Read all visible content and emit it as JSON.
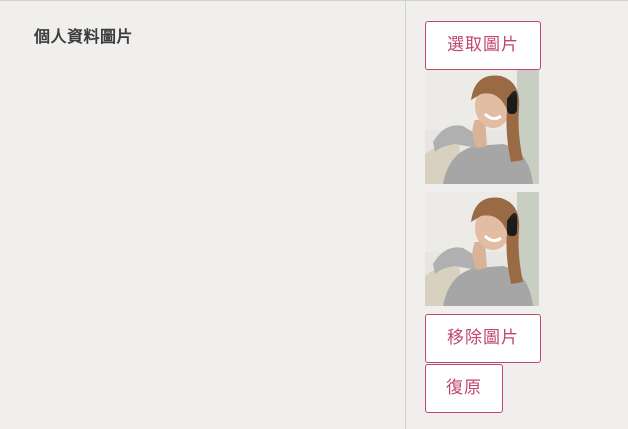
{
  "field": {
    "label": "個人資料圖片"
  },
  "actions": {
    "select_label": "選取圖片",
    "remove_label": "移除圖片",
    "restore_label": "復原"
  },
  "images": [
    {
      "icon": "profile-photo-current"
    },
    {
      "icon": "profile-photo-preview"
    }
  ],
  "colors": {
    "background": "#f0efed",
    "accent": "#c0456f",
    "divider": "#cfcfcf"
  }
}
